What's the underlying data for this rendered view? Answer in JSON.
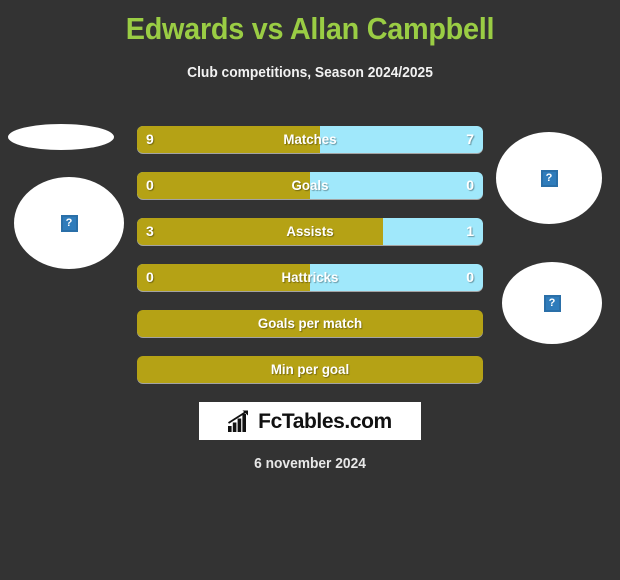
{
  "header": {
    "title": "Edwards vs Allan Campbell",
    "subtitle": "Club competitions, Season 2024/2025",
    "title_color": "#9ACD44"
  },
  "colors": {
    "background": "#333333",
    "home_bar": "#B5A215",
    "away_bar": "#A0E8FB",
    "title_green": "#9ACD44",
    "text_white": "#FFFFFF"
  },
  "avatars": {
    "left_top": {
      "placeholder_glyph": "?"
    },
    "left_main": {
      "placeholder_glyph": "?"
    },
    "right_top": {
      "placeholder_glyph": "?"
    },
    "right_bottom": {
      "placeholder_glyph": "?"
    }
  },
  "chart_data": {
    "type": "bar",
    "title": "Edwards vs Allan Campbell",
    "subtitle": "Club competitions, Season 2024/2025",
    "orientation": "horizontal-diverging",
    "series": [
      {
        "name": "Edwards",
        "color": "#B5A215",
        "side": "left"
      },
      {
        "name": "Allan Campbell",
        "color": "#A0E8FB",
        "side": "right"
      }
    ],
    "categories": [
      "Matches",
      "Goals",
      "Assists",
      "Hattricks",
      "Goals per match",
      "Min per goal"
    ],
    "rows": [
      {
        "label": "Matches",
        "home": "9",
        "away": "7",
        "home_pct": 53,
        "has_values": true
      },
      {
        "label": "Goals",
        "home": "0",
        "away": "0",
        "home_pct": 50,
        "has_values": true
      },
      {
        "label": "Assists",
        "home": "3",
        "away": "1",
        "home_pct": 71,
        "has_values": true
      },
      {
        "label": "Hattricks",
        "home": "0",
        "away": "0",
        "home_pct": 50,
        "has_values": true
      },
      {
        "label": "Goals per match",
        "home": "",
        "away": "",
        "home_pct": 100,
        "has_values": false
      },
      {
        "label": "Min per goal",
        "home": "",
        "away": "",
        "home_pct": 100,
        "has_values": false
      }
    ]
  },
  "footer": {
    "watermark_text": "FcTables.com",
    "watermark_icon": "bar-chart-growth-icon",
    "date": "6 november 2024"
  }
}
